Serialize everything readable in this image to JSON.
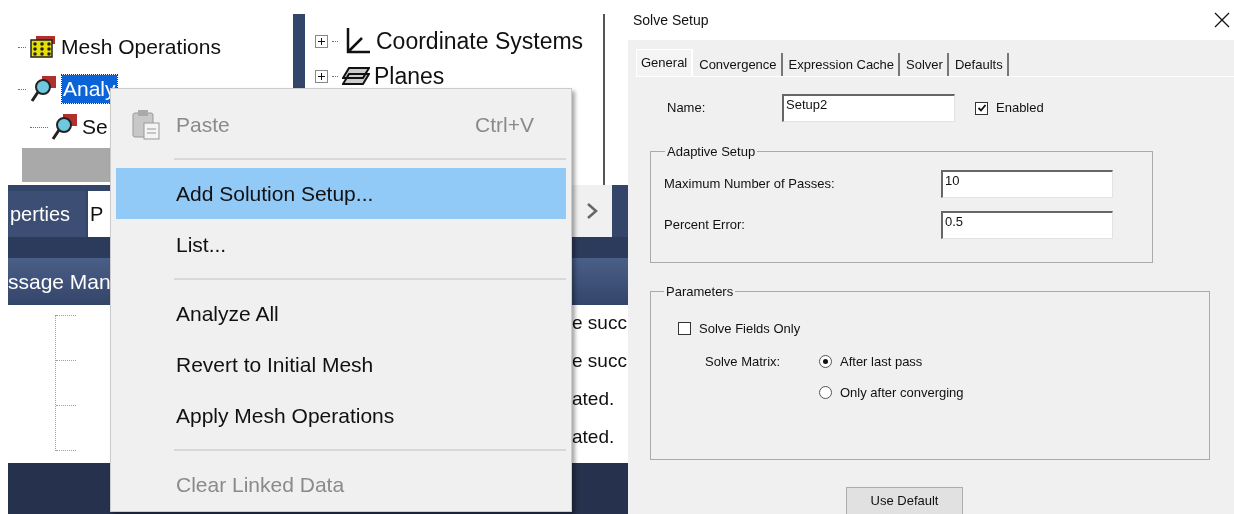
{
  "left_tree": {
    "items": [
      {
        "label": "Mesh Operations",
        "selected": false
      },
      {
        "label": "Analy",
        "selected": true,
        "children": [
          {
            "label": "Se",
            "selected": false
          }
        ]
      }
    ]
  },
  "right_tree": {
    "items": [
      {
        "label": "Coordinate Systems"
      },
      {
        "label": "Planes"
      }
    ]
  },
  "panel_tabs": [
    {
      "label": "perties",
      "selected": false
    },
    {
      "label": "P",
      "selected": true
    }
  ],
  "message_manager": {
    "title": "ssage Man",
    "messages": [
      "e succ",
      "e succ",
      "ated.",
      "ated."
    ]
  },
  "context_menu": {
    "items": [
      {
        "kind": "item",
        "label": "Paste",
        "shortcut": "Ctrl+V",
        "disabled": true,
        "selected": false
      },
      {
        "kind": "separator"
      },
      {
        "kind": "item",
        "label": "Add Solution Setup...",
        "disabled": false,
        "selected": true
      },
      {
        "kind": "item",
        "label": "List...",
        "disabled": false,
        "selected": false
      },
      {
        "kind": "separator"
      },
      {
        "kind": "item",
        "label": "Analyze All",
        "disabled": false,
        "selected": false
      },
      {
        "kind": "item",
        "label": "Revert to Initial Mesh",
        "disabled": false,
        "selected": false
      },
      {
        "kind": "item",
        "label": "Apply Mesh Operations",
        "disabled": false,
        "selected": false
      },
      {
        "kind": "separator"
      },
      {
        "kind": "item",
        "label": "Clear Linked Data",
        "disabled": true,
        "selected": false
      }
    ]
  },
  "dialog": {
    "title": "Solve Setup",
    "tabs": [
      {
        "label": "General",
        "selected": true
      },
      {
        "label": "Convergence",
        "selected": false
      },
      {
        "label": "Expression Cache",
        "selected": false
      },
      {
        "label": "Solver",
        "selected": false
      },
      {
        "label": "Defaults",
        "selected": false
      }
    ],
    "name": {
      "label": "Name:",
      "value": "Setup2"
    },
    "enabled": {
      "label": "Enabled",
      "checked": true
    },
    "adaptive_setup": {
      "title": "Adaptive Setup",
      "fields": [
        {
          "label": "Maximum Number of Passes:",
          "value": "10"
        },
        {
          "label": "Percent Error:",
          "value": "0.5"
        }
      ]
    },
    "parameters": {
      "title": "Parameters",
      "solve_fields_only": {
        "label": "Solve Fields Only",
        "checked": false
      },
      "solve_matrix": {
        "label": "Solve Matrix:",
        "options": [
          {
            "label": "After last pass",
            "selected": true
          },
          {
            "label": "Only after converging",
            "selected": false
          }
        ]
      }
    },
    "buttons": [
      "Use Default"
    ]
  }
}
